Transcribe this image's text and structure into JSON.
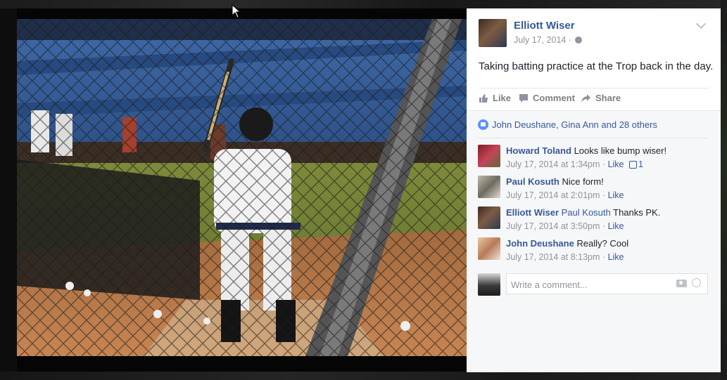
{
  "post": {
    "author": "Elliott Wiser",
    "date": "July 17, 2014 ·",
    "privacy_icon": "globe-icon",
    "text": "Taking batting practice at the Trop back in the day."
  },
  "actions": {
    "like": "Like",
    "comment": "Comment",
    "share": "Share"
  },
  "likes_summary": "John Deushane, Gina Ann and 28 others",
  "comments": [
    {
      "author": "Howard Toland",
      "tag": "",
      "text": "Looks like bump wiser!",
      "time": "July 17, 2014 at 1:34pm",
      "sep": "·",
      "like": "Like",
      "like_count": "1"
    },
    {
      "author": "Paul Kosuth",
      "tag": "",
      "text": "Nice form!",
      "time": "July 17, 2014 at 2:01pm",
      "sep": "·",
      "like": "Like"
    },
    {
      "author": "Elliott Wiser",
      "tag": "Paul Kosuth",
      "text": "Thanks PK.",
      "time": "July 17, 2014 at 3:50pm",
      "sep": "·",
      "like": "Like"
    },
    {
      "author": "John Deushane",
      "tag": "",
      "text": "Really? Cool",
      "time": "July 17, 2014 at 8:13pm",
      "sep": "·",
      "like": "Like"
    }
  ],
  "composer": {
    "placeholder": "Write a comment..."
  },
  "colors": {
    "link": "#365899",
    "meta": "#90949c",
    "like_badge": "#5890ff"
  }
}
